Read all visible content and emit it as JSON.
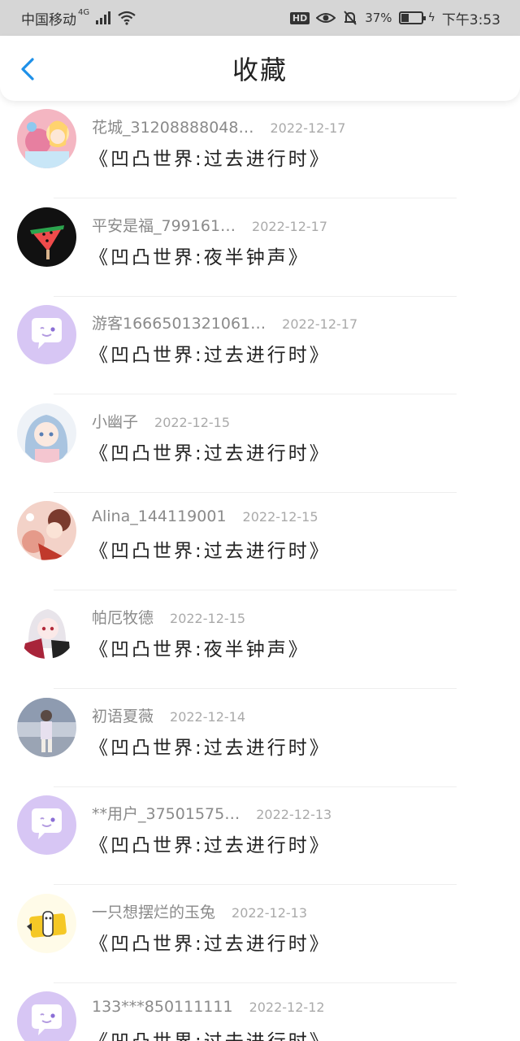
{
  "status_bar": {
    "carrier": "中国移动",
    "network": "4G",
    "hd": "HD",
    "battery_percent": "37%",
    "battery_level": 0.37,
    "time": "下午3:53"
  },
  "header": {
    "title": "收藏",
    "back_icon": "chevron-left-icon"
  },
  "colors": {
    "accent": "#1e90e8",
    "status_bar_bg": "#d6d6d6",
    "default_avatar_bg": "#d7c6f4"
  },
  "items": [
    {
      "user": "花城_31208888048…",
      "date": "2022-12-17",
      "title": "《凹凸世界:过去进行时》",
      "avatar": "anime-avatar-pink"
    },
    {
      "user": "平安是福_799161…",
      "date": "2022-12-17",
      "title": "《凹凸世界:夜半钟声》",
      "avatar": "watermelon-popsicle-avatar"
    },
    {
      "user": "游客1666501321061…",
      "date": "2022-12-17",
      "title": "《凹凸世界:过去进行时》",
      "avatar": "default-chat-bubble-avatar"
    },
    {
      "user": "小幽子",
      "date": "2022-12-15",
      "title": "《凹凸世界:过去进行时》",
      "avatar": "anime-avatar-blue-hair"
    },
    {
      "user": "Alina_144119001",
      "date": "2022-12-15",
      "title": "《凹凸世界:过去进行时》",
      "avatar": "anime-avatar-red"
    },
    {
      "user": "帕厄牧德",
      "date": "2022-12-15",
      "title": "《凹凸世界:夜半钟声》",
      "avatar": "anime-avatar-white-hair"
    },
    {
      "user": "初语夏薇",
      "date": "2022-12-14",
      "title": "《凹凸世界:过去进行时》",
      "avatar": "photo-avatar-girl"
    },
    {
      "user": "**用户_37501575…",
      "date": "2022-12-13",
      "title": "《凹凸世界:过去进行时》",
      "avatar": "default-chat-bubble-avatar"
    },
    {
      "user": "一只想摆烂的玉兔",
      "date": "2022-12-13",
      "title": "《凹凸世界:过去进行时》",
      "avatar": "rabbit-sticker-avatar"
    },
    {
      "user": "133***850111111",
      "date": "2022-12-12",
      "title": "《凹凸世界:过去进行时》",
      "avatar": "default-chat-bubble-avatar"
    }
  ]
}
